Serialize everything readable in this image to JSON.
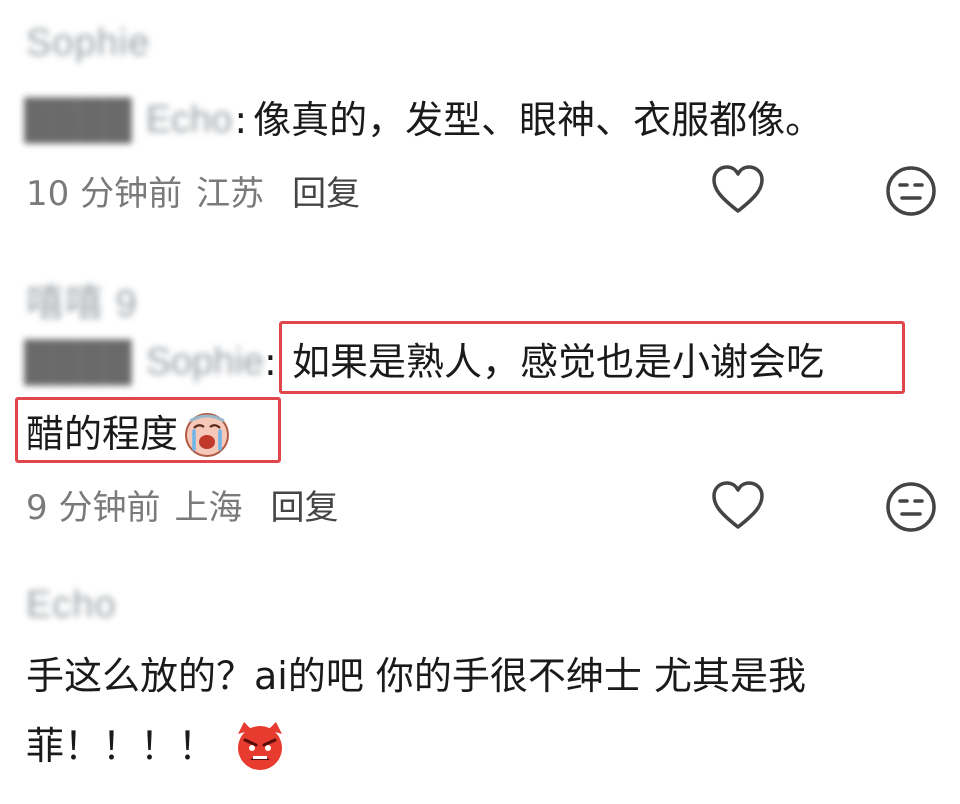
{
  "colors": {
    "highlight_border": "#e0474c",
    "meta_text": "#7a7a7a",
    "blurred_text": "#9aa0a6"
  },
  "comments": [
    {
      "username": "Sophie",
      "reply_user_a": "████",
      "reply_user_b": "Echo",
      "text": "像真的，发型、眼神、衣服都像。",
      "time": "10 分钟前",
      "location": "江苏",
      "reply_label": "回复",
      "like_icon": "heart-outline",
      "dislike_icon": "meh-face"
    },
    {
      "username": "嘻嘻 9",
      "reply_user_a": "████",
      "reply_user_b": "Sophie",
      "text_line1": "如果是熟人，感觉也是小谢会吃",
      "text_line2": "醋的程度",
      "emoji": "crying-face",
      "time": "9 分钟前",
      "location": "上海",
      "reply_label": "回复",
      "like_icon": "heart-outline",
      "dislike_icon": "meh-face"
    },
    {
      "username": "Echo",
      "text_line1": "手这么放的？ai的吧 你的手很不绅士 尤其是我",
      "text_line2": "菲！！！！",
      "emoji": "angry-face"
    }
  ]
}
